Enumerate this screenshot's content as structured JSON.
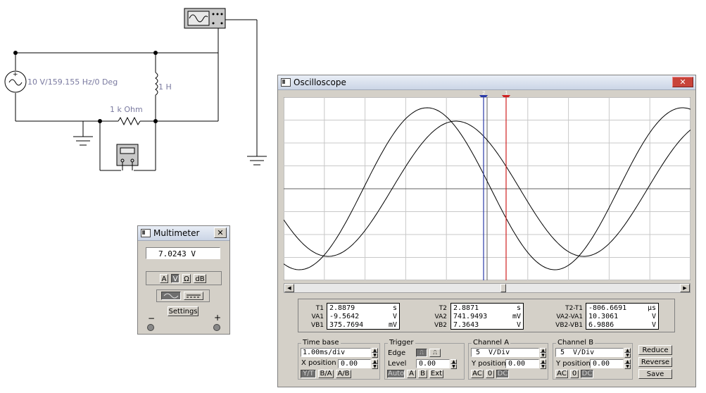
{
  "schematic": {
    "source_label": "10 V/159.155 Hz/0 Deg",
    "inductor_label": "1 H",
    "resistor_label": "1 k Ohm"
  },
  "multimeter": {
    "title": "Multimeter",
    "display_value": "7.0243  V",
    "mode_buttons": [
      "A",
      "V",
      "Ω",
      "dB"
    ],
    "active_mode": "V",
    "settings_label": "Settings",
    "minus": "−",
    "plus": "+"
  },
  "oscilloscope": {
    "title": "Oscilloscope",
    "cursor1": "1",
    "cursor2": "2",
    "readouts": {
      "col1_labels": [
        "T1",
        "VA1",
        "VB1"
      ],
      "col1_values": [
        [
          "2.8879",
          "s"
        ],
        [
          "-9.5642",
          "V"
        ],
        [
          "375.7694",
          "mV"
        ]
      ],
      "col2_labels": [
        "T2",
        "VA2",
        "VB2"
      ],
      "col2_values": [
        [
          "2.8871",
          "s"
        ],
        [
          "741.9493",
          "mV"
        ],
        [
          "7.3643",
          "V"
        ]
      ],
      "col3_labels": [
        "T2-T1",
        "VA2-VA1",
        "VB2-VB1"
      ],
      "col3_values": [
        [
          "-806.6691",
          "µs"
        ],
        [
          "10.3061",
          "V"
        ],
        [
          "6.9886",
          "V"
        ]
      ]
    },
    "timebase": {
      "title": "Time base",
      "value": "1.00ms/div",
      "xpos_label": "X position",
      "xpos_value": "0.00",
      "buttons": [
        "Y/T",
        "B/A",
        "A/B"
      ],
      "active": "Y/T"
    },
    "trigger": {
      "title": "Trigger",
      "edge_label": "Edge",
      "level_label": "Level",
      "level_value": "0.00",
      "buttons": [
        "Auto",
        "A",
        "B",
        "Ext"
      ],
      "active": "Auto"
    },
    "channel_a": {
      "title": "Channel A",
      "value": "5  V/Div",
      "ypos_label": "Y position",
      "ypos_value": "0.00",
      "buttons": [
        "AC",
        "0",
        "DC"
      ],
      "active": "DC"
    },
    "channel_b": {
      "title": "Channel B",
      "value": "5  V/Div",
      "ypos_label": "Y position",
      "ypos_value": "0.00",
      "buttons": [
        "AC",
        "0",
        "DC"
      ],
      "active": "DC"
    },
    "side_buttons": [
      "Reduce",
      "Reverse",
      "Save"
    ]
  }
}
